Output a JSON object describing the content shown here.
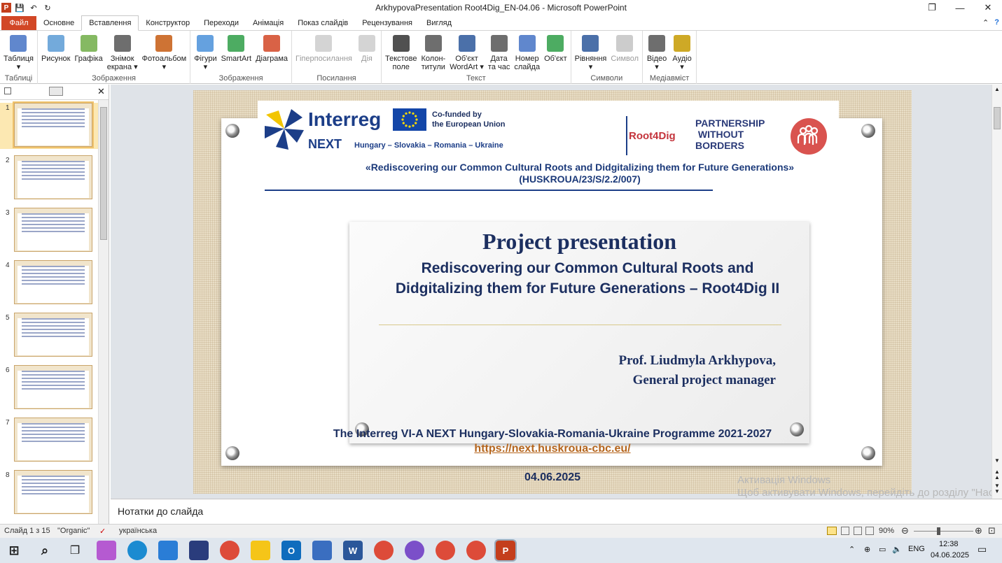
{
  "window": {
    "title": "ArkhypovaPresentation Root4Dig_EN-04.06  -  Microsoft PowerPoint",
    "app_letter": "P",
    "qa_undo": "↶",
    "qa_redo": "↻",
    "qa_save": "💾",
    "controls": {
      "minimize": "—",
      "restore": "❐",
      "close": "✕"
    }
  },
  "ribbon_tabs": [
    "Файл",
    "Основне",
    "Вставлення",
    "Конструктор",
    "Переходи",
    "Анімація",
    "Показ слайдів",
    "Рецензування",
    "Вигляд"
  ],
  "ribbon_help": "?",
  "ribbon_caret": "⌃",
  "ribbon_groups": [
    {
      "label": "Таблиці",
      "buttons": [
        {
          "label": "Таблиця\n▾",
          "icon": "table-icon",
          "color": "#4472c4"
        }
      ]
    },
    {
      "label": "Зображення",
      "buttons": [
        {
          "label": "Рисунок",
          "icon": "picture-icon",
          "color": "#5b9bd5"
        },
        {
          "label": "Графіка",
          "icon": "clipart-icon",
          "color": "#70ad47"
        },
        {
          "label": "Знімок\nекрана ▾",
          "icon": "screenshot-icon",
          "color": "#555555"
        },
        {
          "label": "Фотоальбом\n▾",
          "icon": "photo-album-icon",
          "color": "#c55a11"
        }
      ]
    },
    {
      "label": "Зображення",
      "buttons": [
        {
          "label": "Фігури\n▾",
          "icon": "shapes-icon",
          "color": "#4a90d9"
        },
        {
          "label": "SmartArt",
          "icon": "smartart-icon",
          "color": "#2e9e46"
        },
        {
          "label": "Діаграма",
          "icon": "chart-icon",
          "color": "#d24726"
        }
      ]
    },
    {
      "label": "Посилання",
      "buttons": [
        {
          "label": "Гіперпосилання",
          "icon": "hyperlink-icon",
          "color": "#aaaaaa",
          "disabled": true
        },
        {
          "label": "Дія",
          "icon": "action-icon",
          "color": "#aaaaaa",
          "disabled": true
        }
      ]
    },
    {
      "label": "Текст",
      "buttons": [
        {
          "label": "Текстове\nполе",
          "icon": "textbox-icon",
          "color": "#333333"
        },
        {
          "label": "Колон-\nтитули",
          "icon": "header-footer-icon",
          "color": "#555555"
        },
        {
          "label": "Об'єкт\nWordArt ▾",
          "icon": "wordart-icon",
          "color": "#2b579a"
        },
        {
          "label": "Дата\nта час",
          "icon": "datetime-icon",
          "color": "#555555"
        },
        {
          "label": "Номер\nслайда",
          "icon": "slide-number-icon",
          "color": "#4472c4"
        },
        {
          "label": "Об'єкт",
          "icon": "object-icon",
          "color": "#2e9e46"
        }
      ]
    },
    {
      "label": "Символи",
      "buttons": [
        {
          "label": "Рівняння\n▾",
          "icon": "equation-icon",
          "color": "#2b579a"
        },
        {
          "label": "Символ",
          "icon": "symbol-icon",
          "color": "#999999",
          "disabled": true
        }
      ]
    },
    {
      "label": "Медіавміст",
      "buttons": [
        {
          "label": "Відео\n▾",
          "icon": "video-icon",
          "color": "#555555"
        },
        {
          "label": "Аудіо\n▾",
          "icon": "audio-icon",
          "color": "#c59a00"
        }
      ]
    }
  ],
  "thumbnails": [
    {
      "num": "1"
    },
    {
      "num": "2"
    },
    {
      "num": "3"
    },
    {
      "num": "4"
    },
    {
      "num": "5"
    },
    {
      "num": "6"
    },
    {
      "num": "7"
    },
    {
      "num": "8"
    }
  ],
  "slide": {
    "banner": {
      "interreg": "Interreg",
      "next": "NEXT",
      "next_sub": "Hungary – Slovakia – Romania – Ukraine",
      "cofunded": "Co-funded by\nthe European Union",
      "root4dig": "Root4Dig",
      "partnership": "PARTNERSHIP\n WITHOUT\nBORDERS",
      "title": "«Rediscovering our Common Cultural Roots and Didgitalizing them for Future Generations» (HUSKROUA/23/S/2.2/007)"
    },
    "main_title": "Project presentation",
    "subtitle": "Rediscovering our Common Cultural Roots and Didgitalizing them for Future Generations – Root4Dig II",
    "author": "Prof. Liudmyla Arkhypova,",
    "author_role": "General project manager",
    "programme": "The Interreg VI-A NEXT Hungary-Slovakia-Romania-Ukraine  Programme  2021-2027",
    "url": "https://next.huskroua-cbc.eu/",
    "date": "04.06.2025"
  },
  "notes": {
    "placeholder": "Нотатки до слайда"
  },
  "activation": "Активація Windows\nЩоб активувати Windows, перейдіть до розділу \"Настройки\".\nWindows.",
  "status": {
    "slide": "Слайд 1 з 15",
    "theme": "\"Organic\"",
    "language": "українська",
    "zoom": "90%"
  },
  "taskbar": {
    "lang": "ENG",
    "time": "12:38",
    "date": "04.06.2025"
  }
}
